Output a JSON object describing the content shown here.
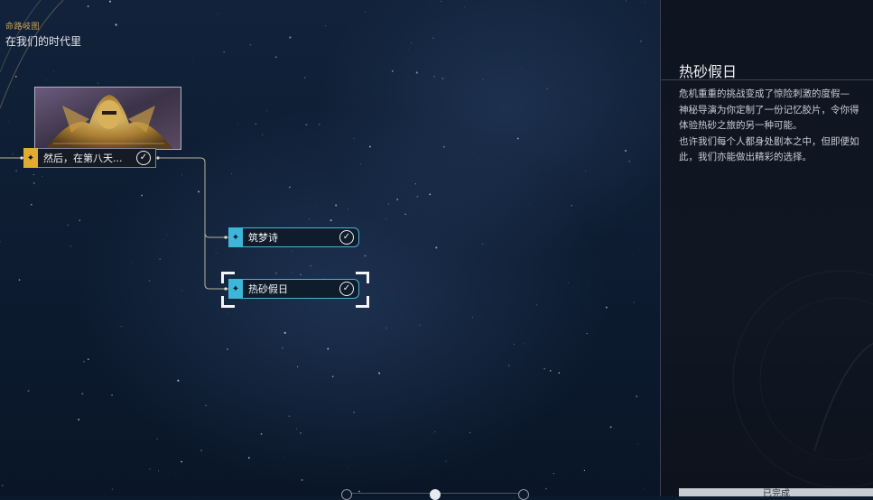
{
  "header": {
    "breadcrumb": "命路岐图",
    "chapter_title": "在我们的时代里"
  },
  "nodes": {
    "start": {
      "label": "然后，在第八天...",
      "completed": true,
      "badge_icon": "star-compass-icon"
    },
    "branch_a": {
      "label": "筑梦诗",
      "completed": true,
      "badge_icon": "star-compass-icon"
    },
    "branch_b": {
      "label": "热砂假日",
      "completed": true,
      "selected": true,
      "badge_icon": "star-compass-icon"
    }
  },
  "detail_panel": {
    "title": "热砂假日",
    "description_lines": [
      "危机重重的挑战变成了惊险刺激的度假—",
      "神秘导演为你定制了一份记忆胶片，令你得",
      "体验热砂之旅的另一种可能。",
      "也许我们每个人都身处剧本之中，但即便如",
      "此，我们亦能做出精彩的选择。"
    ],
    "status_button": "已完成"
  },
  "colors": {
    "gold_accent": "#e2ac33",
    "cyan_accent": "#3fb6d8",
    "background": "#0c1a2e",
    "panel_bg": "#0e1420"
  },
  "scrollbar": {
    "position": 0.5
  }
}
